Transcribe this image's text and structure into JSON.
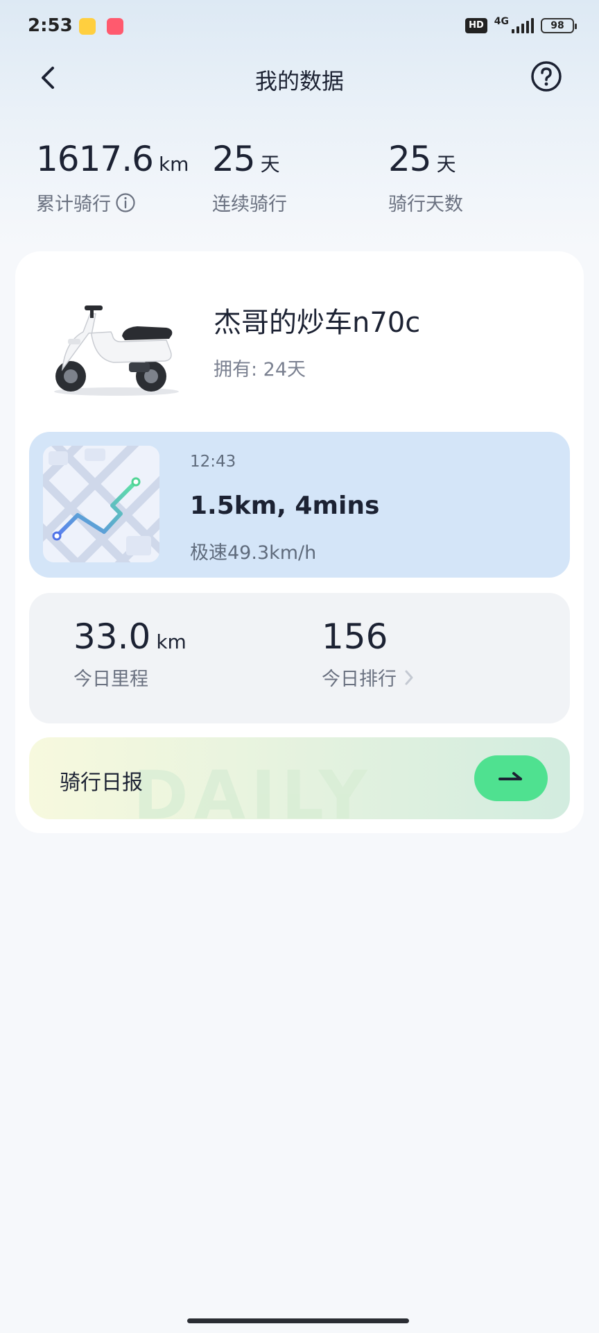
{
  "status_bar": {
    "time": "2:53",
    "hd": "HD",
    "network": "4G",
    "battery": "98"
  },
  "header": {
    "title": "我的数据"
  },
  "stats": [
    {
      "value": "1617.6",
      "unit": "km",
      "label": "累计骑行"
    },
    {
      "value": "25",
      "unit": "天",
      "label": "连续骑行"
    },
    {
      "value": "25",
      "unit": "天",
      "label": "骑行天数"
    }
  ],
  "vehicle": {
    "name": "杰哥的炒车n70c",
    "owned": "拥有: 24天"
  },
  "last_ride": {
    "time": "12:43",
    "summary": "1.5km, 4mins",
    "top_speed": "极速49.3km/h"
  },
  "today": {
    "mileage_value": "33.0",
    "mileage_unit": "km",
    "mileage_label": "今日里程",
    "rank_value": "156",
    "rank_label": "今日排行"
  },
  "daily_report": {
    "label": "骑行日报",
    "watermark": "DAILY"
  },
  "colors": {
    "accent_green": "#4fe190",
    "ride_card_bg": "#d4e5f8"
  }
}
